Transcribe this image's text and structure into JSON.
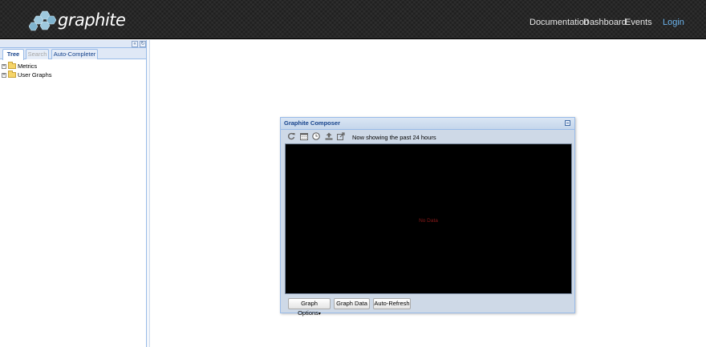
{
  "header": {
    "logo_text": "graphite",
    "nav": [
      "Documentation",
      "Dashboard",
      "Events"
    ],
    "login": "Login"
  },
  "left_panel": {
    "collapse_icon": "double-chevron-left-icon",
    "refresh_icon": "refresh-icon",
    "tabs": [
      {
        "label": "Tree",
        "state": "active"
      },
      {
        "label": "Search",
        "state": "disabled"
      },
      {
        "label": "Auto-Completer",
        "state": "normal"
      }
    ],
    "tree": [
      {
        "label": "Metrics",
        "icon": "folder-icon"
      },
      {
        "label": "User Graphs",
        "icon": "folder-icon"
      }
    ]
  },
  "composer": {
    "title": "Graphite Composer",
    "toolbar_icons": [
      "refresh-icon",
      "calendar-icon",
      "clock-icon",
      "upload-icon",
      "share-icon"
    ],
    "status_text": "Now showing the past 24 hours",
    "graph_message": "No Data",
    "buttons": {
      "graph_options": "Graph Options",
      "graph_data": "Graph Data",
      "auto_refresh": "Auto-Refresh"
    },
    "colors": {
      "graph_bg": "#000000",
      "no_data": "#8b1a1a",
      "title": "#15428b"
    }
  }
}
